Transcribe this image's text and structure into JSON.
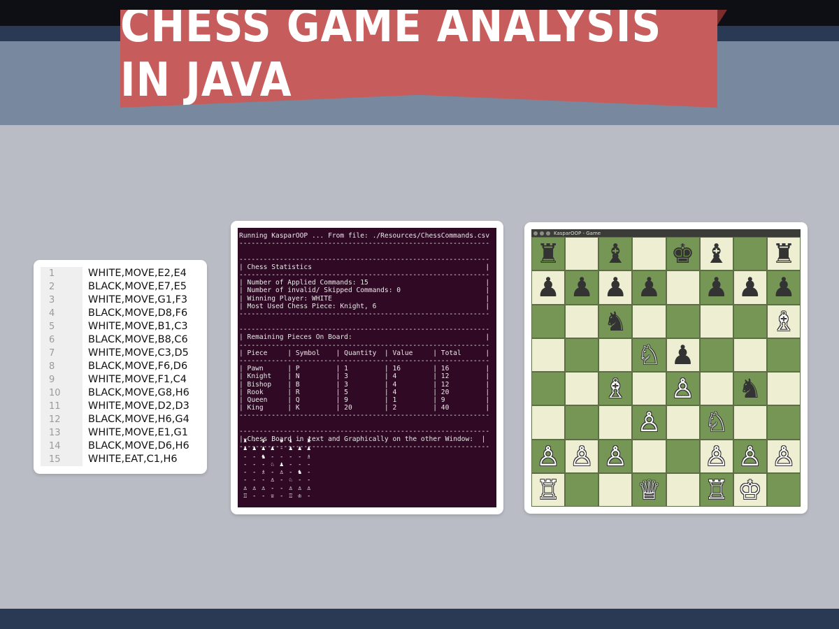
{
  "banner": {
    "title": "CHESS GAME ANALYSIS IN JAVA"
  },
  "colors": {
    "ribbon": "#c75c5c",
    "terminal_bg": "#300a24",
    "board_light": "#eeeed2",
    "board_dark": "#769656"
  },
  "csv": {
    "lines": [
      {
        "num": "1",
        "text": "WHITE,MOVE,E2,E4"
      },
      {
        "num": "2",
        "text": "BLACK,MOVE,E7,E5"
      },
      {
        "num": "3",
        "text": "WHITE,MOVE,G1,F3"
      },
      {
        "num": "4",
        "text": "BLACK,MOVE,D8,F6"
      },
      {
        "num": "5",
        "text": "WHITE,MOVE,B1,C3"
      },
      {
        "num": "6",
        "text": "BLACK,MOVE,B8,C6"
      },
      {
        "num": "7",
        "text": "WHITE,MOVE,C3,D5"
      },
      {
        "num": "8",
        "text": "BLACK,MOVE,F6,D6"
      },
      {
        "num": "9",
        "text": "WHITE,MOVE,F1,C4"
      },
      {
        "num": "10",
        "text": "BLACK,MOVE,G8,H6"
      },
      {
        "num": "11",
        "text": "WHITE,MOVE,D2,D3"
      },
      {
        "num": "12",
        "text": "BLACK,MOVE,H6,G4"
      },
      {
        "num": "13",
        "text": "WHITE,MOVE,E1,G1"
      },
      {
        "num": "14",
        "text": "BLACK,MOVE,D6,H6"
      },
      {
        "num": "15",
        "text": "WHITE,EAT,C1,H6"
      }
    ]
  },
  "terminal": {
    "lines": [
      "Running KasparOOP ... From file: ./Resources/ChessCommands.csv",
      "--------------------------------------------------------------",
      "",
      "--------------------------------------------------------------",
      "| Chess Statistics                                           |",
      "--------------------------------------------------------------",
      "| Number of Applied Commands: 15                             |",
      "| Number of invalid/ Skipped Commands: 0                     |",
      "| Winning Player: WHITE                                      |",
      "| Most Used Chess Piece: Knight, 6                           |",
      "--------------------------------------------------------------",
      "",
      "--------------------------------------------------------------",
      "| Remaining Pieces On Board:                                 |",
      "--------------------------------------------------------------",
      "| Piece     | Symbol    | Quantity  | Value     | Total      |",
      "--------------------------------------------------------------",
      "| Pawn      | P         | 1         | 16        | 16         |",
      "| Knight    | N         | 3         | 4         | 12         |",
      "| Bishop    | B         | 3         | 4         | 12         |",
      "| Rook      | R         | 5         | 4         | 20         |",
      "| Queen     | Q         | 9         | 1         | 9          |",
      "| King      | K         | 20        | 2         | 40         |",
      "--------------------------------------------------------------",
      "",
      "--------------------------------------------------------------",
      "| Chess Board in text and Graphically on the other Window:  |",
      "--------------------------------------------------------------"
    ],
    "mini_board": [
      [
        "♜",
        "-",
        "♝",
        "-",
        "♚",
        "♝",
        "-",
        "♜"
      ],
      [
        "♟",
        "♟",
        "♟",
        "♟",
        "-",
        "♟",
        "♟",
        "♟"
      ],
      [
        "-",
        "-",
        "♞",
        "-",
        "-",
        "-",
        "-",
        "♗"
      ],
      [
        "-",
        "-",
        "-",
        "♘",
        "♟",
        "-",
        "-",
        "-"
      ],
      [
        "-",
        "-",
        "♗",
        "-",
        "♙",
        "-",
        "♞",
        "-"
      ],
      [
        "-",
        "-",
        "-",
        "♙",
        "-",
        "♘",
        "-",
        "-"
      ],
      [
        "♙",
        "♙",
        "♙",
        "-",
        "-",
        "♙",
        "♙",
        "♙"
      ],
      [
        "♖",
        "-",
        "-",
        "♕",
        "-",
        "♖",
        "♔",
        "-"
      ]
    ]
  },
  "game_window": {
    "title": "KasparOOP - Game",
    "board": [
      [
        "♜",
        "",
        "♝",
        "",
        "♚",
        "♝",
        "",
        "♜"
      ],
      [
        "♟",
        "♟",
        "♟",
        "♟",
        "",
        "♟",
        "♟",
        "♟"
      ],
      [
        "",
        "",
        "♞",
        "",
        "",
        "",
        "",
        "♗"
      ],
      [
        "",
        "",
        "",
        "♘",
        "♟",
        "",
        "",
        ""
      ],
      [
        "",
        "",
        "♗",
        "",
        "♙",
        "",
        "♞",
        ""
      ],
      [
        "",
        "",
        "",
        "♙",
        "",
        "♘",
        "",
        ""
      ],
      [
        "♙",
        "♙",
        "♙",
        "",
        "",
        "♙",
        "♙",
        "♙"
      ],
      [
        "♖",
        "",
        "",
        "♕",
        "",
        "♖",
        "♔",
        ""
      ]
    ]
  }
}
